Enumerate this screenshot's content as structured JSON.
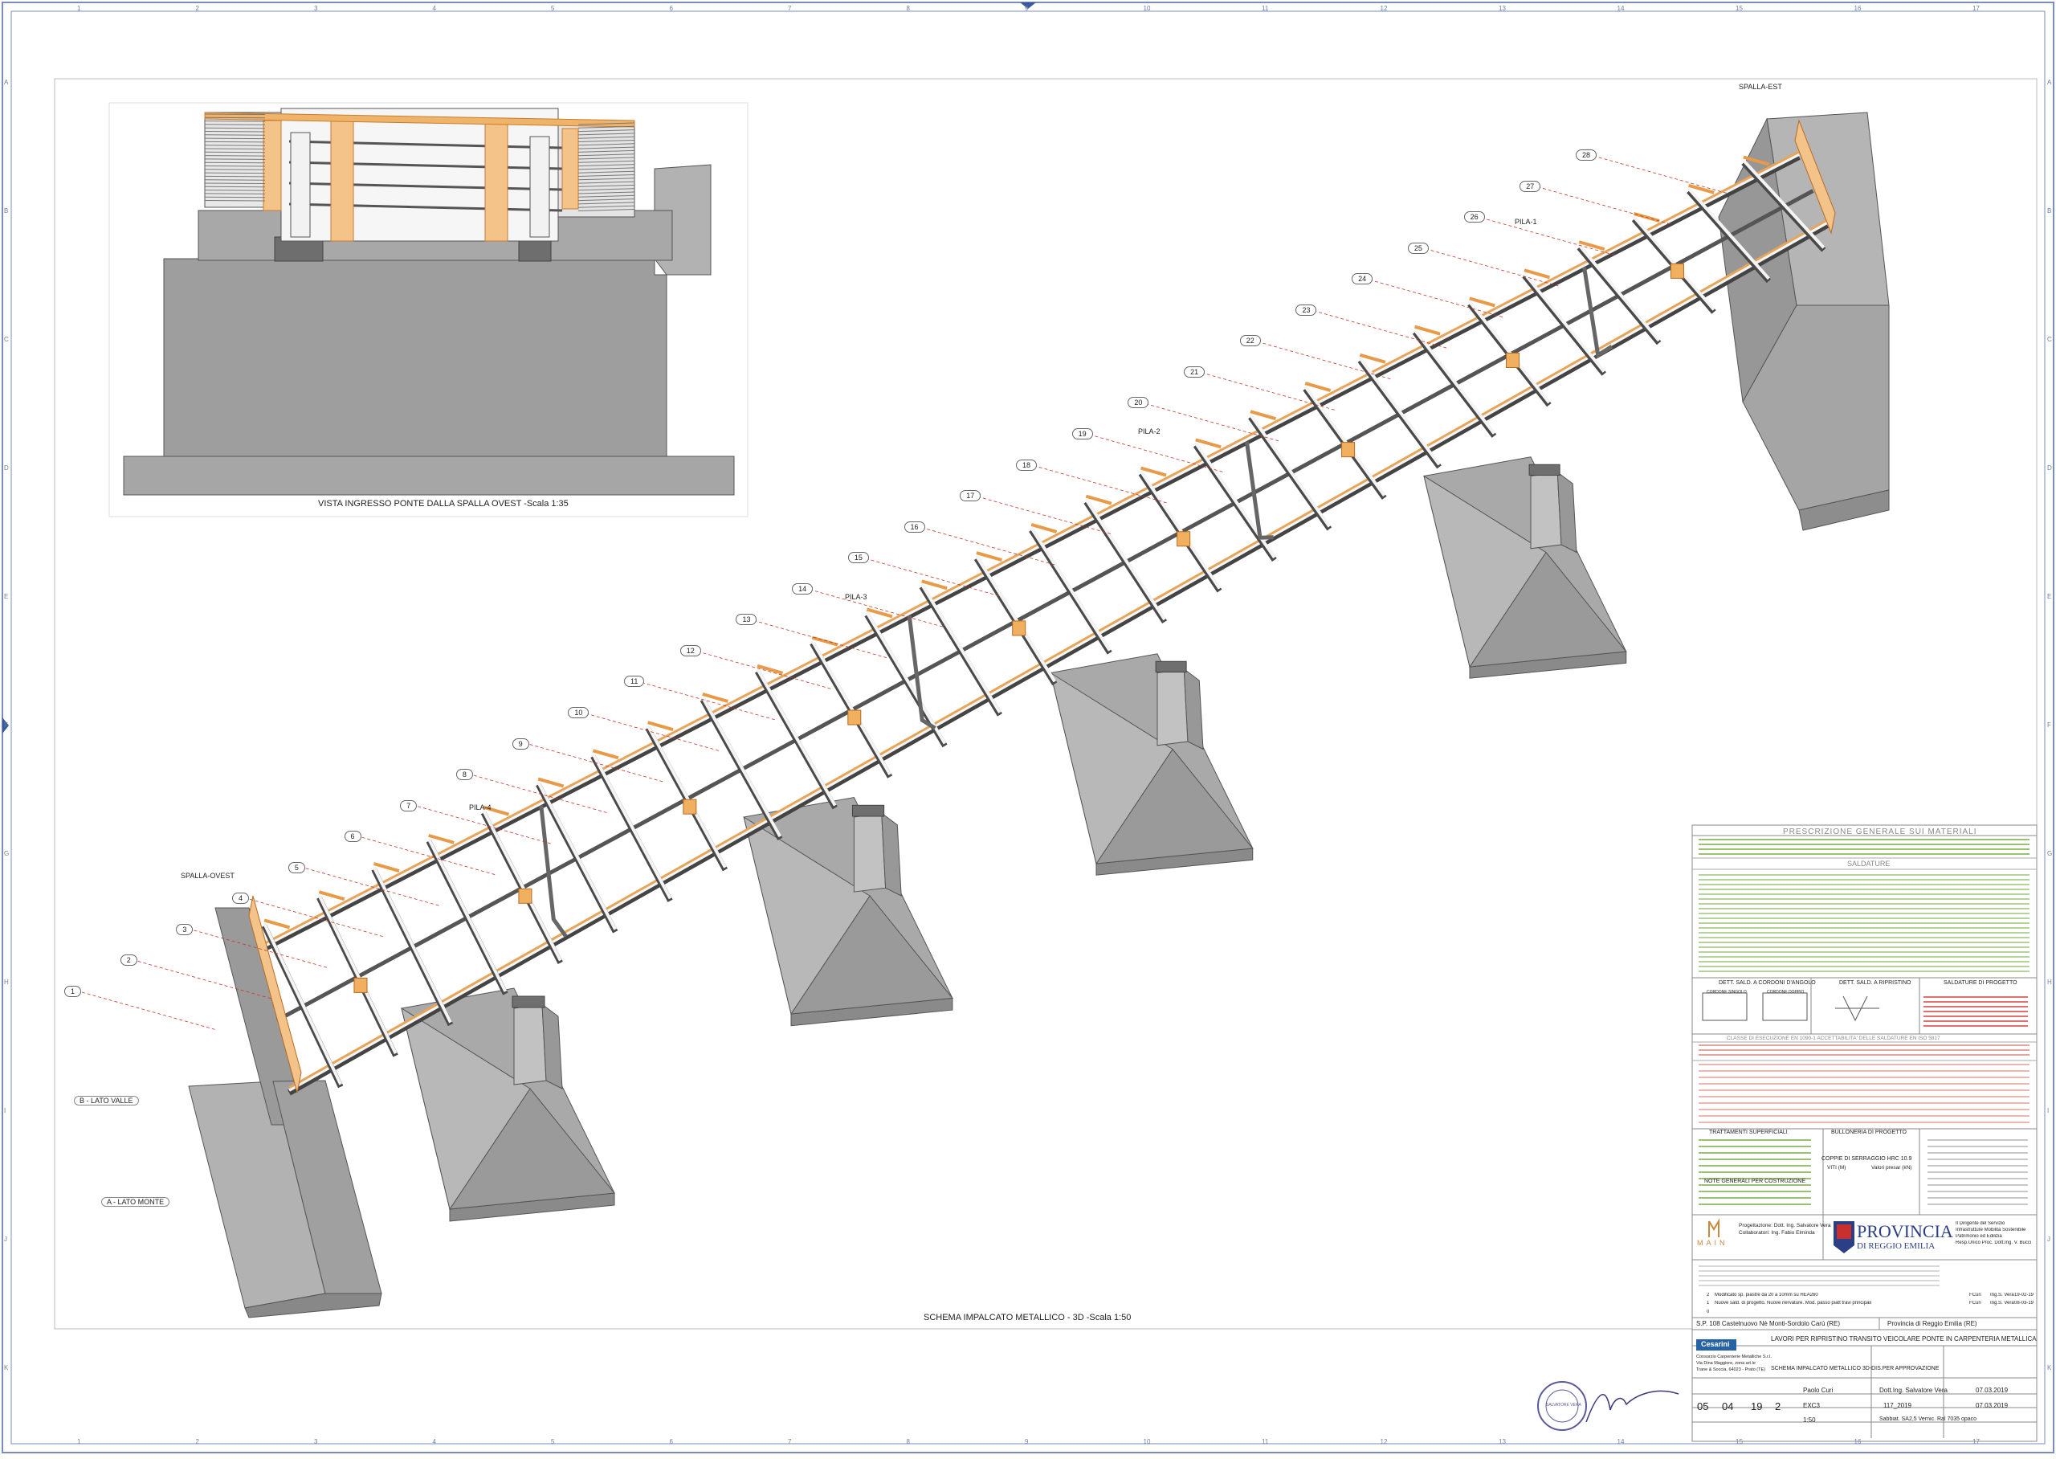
{
  "frame": {
    "col_numbers": [
      "1",
      "2",
      "3",
      "4",
      "5",
      "6",
      "7",
      "8",
      "9",
      "10",
      "11",
      "12",
      "13",
      "14",
      "15",
      "16",
      "17"
    ],
    "row_letters": [
      "A",
      "B",
      "C",
      "D",
      "E",
      "F",
      "G",
      "H",
      "I",
      "J",
      "K"
    ]
  },
  "inset_view": {
    "caption": "VISTA INGRESSO PONTE DALLA SPALLA OVEST -Scala 1:35"
  },
  "main_view": {
    "caption": "SCHEMA IMPALCATO METALLICO - 3D -Scala 1:50",
    "labels": {
      "spalla_est": "SPALLA-EST",
      "spalla_ovest": "SPALLA-OVEST",
      "pila_1": "PILA-1",
      "pila_2": "PILA-2",
      "pila_3": "PILA-3",
      "pila_4": "PILA-4",
      "lato_valle": "B - LATO VALLE",
      "lato_monte": "A - LATO MONTE"
    },
    "bubbles": [
      "1",
      "2",
      "3",
      "4",
      "5",
      "6",
      "7",
      "8",
      "9",
      "10",
      "11",
      "12",
      "13",
      "14",
      "15",
      "16",
      "17",
      "18",
      "19",
      "20",
      "21",
      "22",
      "23",
      "24",
      "25",
      "26",
      "27",
      "28"
    ]
  },
  "title_block": {
    "materials_title": "PRESCRIZIONE GENERALE SUI MATERIALI",
    "saldature_title": "SALDATURE",
    "dett_angolo": "DETT. SALD. A CORDONI D'ANGOLO",
    "dett_ripristino": "DETT. SALD. A RIPRISTINO",
    "saldature_progetto": "SALDATURE DI PROGETTO",
    "cordone_singolo": "CORDONE SINGOLO",
    "cordone_doppio": "CORDONE DOPPIO",
    "classe_esecuzione": "CLASSE DI ESECUZIONE EN 1090-1 ACCETTABILITA' DELLE SALDATURE EN ISO 5817",
    "trattamenti": "TRATTAMENTI SUPERFICIALI",
    "bulloneria": "BULLONERIA DI PROGETTO",
    "coppie_serraggio": "COPPIE DI SERRAGGIO HRC 10.9",
    "viti_col": "VITI (M)",
    "valori_col": "Valori presar (kN)",
    "note_generali": "NOTE GENERALI PER COSTRUZIONE",
    "progettazione": "Progettazione: Dott. Ing. Salvatore Vera",
    "collaboratori": "Collaboratori: Ing. Fabio Elminda",
    "provincia_name": "PROVINCIA",
    "provincia_sub": "DI REGGIO EMILIA",
    "main_logo": "MAIN",
    "servizio_1": "Il Dirigente del Servizio",
    "servizio_2": "Infrastrutture Mobilità Sostenibile",
    "servizio_3": "Patrimonio ed Edilizia",
    "servizio_4": "Resp.Unico Proc. Dott.Ing. V. Bucci",
    "rev_2": "2",
    "rev_2_text": "Modificato sp. piastre da 20 a 10mm su HEA260",
    "rev_2_by": "FCuri",
    "rev_2_chk": "Ing.S. Vera",
    "rev_2_date": "19-02-19",
    "rev_1": "1",
    "rev_1_text": "Nuove sald. di progetto. Nuove nervature. Mod. passo piatt travi principali",
    "rev_1_by": "FCuri",
    "rev_1_chk": "Ing.S. Vera",
    "rev_1_date": "08-03-19",
    "rev_0": "0",
    "location": "S.P. 108 Castelnuovo Nè Monti-Sordolo Carù (RE)",
    "client": "Provincia di Reggio Emilia (RE)",
    "project": "LAVORI PER RIPRISTINO TRANSITO VEICOLARE PONTE IN CARPENTERIA METALLICA",
    "drawing_title": "SCHEMA IMPALCATO METALLICO 3D-DIS.PER APPROVAZIONE",
    "cesarini": "Cesarini",
    "company_1": "Consorzio Carpenterie Metalliche S.r.l.",
    "company_2": "Via Dina Maggiore, zona art.le",
    "company_3": "Trane & Soccia, 64023 - Prato (TE)",
    "drawn_by": "Paolo Curi",
    "checked_by": "Dott.Ing. Salvatore Vera",
    "date_1": "07.03.2019",
    "code_1": "05",
    "code_2": "04",
    "code_3": "19",
    "code_4": "2",
    "exc": "EXC3",
    "job": "117_2019",
    "date_2": "07.03.2019",
    "scale": "1:50",
    "finish": "Sabbiat. SA2,5 Verniс. Ral 7035 opaco",
    "stamp": "SALVATORE VERA"
  }
}
